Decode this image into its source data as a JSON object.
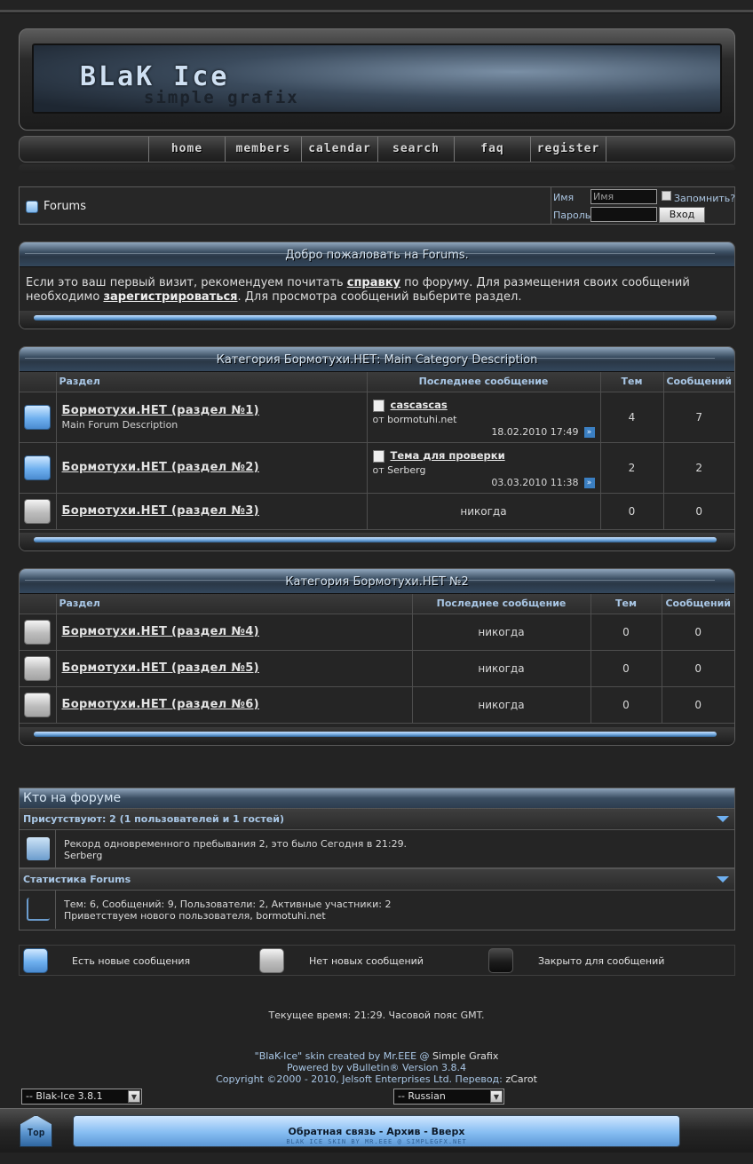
{
  "header": {
    "logo_line1": "BLaK Ice",
    "logo_line2": "simple grafix"
  },
  "nav": [
    "home",
    "members",
    "calendar",
    "search",
    "faq",
    "register"
  ],
  "breadcrumb": {
    "title": "Forums"
  },
  "login": {
    "user_label": "Имя",
    "user_value": "Имя",
    "remember_label": "Запомнить?",
    "pass_label": "Пароль",
    "submit": "Вход"
  },
  "welcome": {
    "title": "Добро пожаловать на Forums.",
    "text_a": "Если это ваш первый визит, рекомендуем почитать ",
    "link_help": "справку",
    "text_b": " по форуму. Для размещения своих сообщений необходимо ",
    "link_register": "зарегистрироваться",
    "text_c": ". Для просмотра сообщений выберите раздел."
  },
  "category1": {
    "title": "Категория Бормотухи.НЕТ: Main Category Description",
    "col_forum": "Раздел",
    "col_last": "Последнее сообщение",
    "col_threads": "Тем",
    "col_posts": "Сообщений",
    "rows": [
      {
        "name": "Бормотухи.НЕТ (раздел №1)",
        "desc": "Main Forum Description",
        "last_title": "cascascas",
        "last_by": "от",
        "last_user": "bormotuhi.net",
        "last_date": "18.02.2010 17:49",
        "threads": "4",
        "posts": "7"
      },
      {
        "name": "Бормотухи.НЕТ (раздел №2)",
        "desc": "",
        "last_title": "Тема для проверки",
        "last_by": "от",
        "last_user": "Serberg",
        "last_date": "03.03.2010 11:38",
        "threads": "2",
        "posts": "2"
      },
      {
        "name": "Бормотухи.НЕТ (раздел №3)",
        "desc": "",
        "last_never": "никогда",
        "threads": "0",
        "posts": "0"
      }
    ]
  },
  "category2": {
    "title": "Категория Бормотухи.НЕТ №2",
    "col_forum": "Раздел",
    "col_last": "Последнее сообщение",
    "col_threads": "Тем",
    "col_posts": "Сообщений",
    "rows": [
      {
        "name": "Бормотухи.НЕТ (раздел №4)",
        "last_never": "никогда",
        "threads": "0",
        "posts": "0"
      },
      {
        "name": "Бормотухи.НЕТ (раздел №5)",
        "last_never": "никогда",
        "threads": "0",
        "posts": "0"
      },
      {
        "name": "Бормотухи.НЕТ (раздел №6)",
        "last_never": "никогда",
        "threads": "0",
        "posts": "0"
      }
    ]
  },
  "whosonline": {
    "title": "Кто на форуме",
    "present_link": "Присутствуют",
    "present_text": ": 2 (1 пользователей и 1 гостей)",
    "record_text": "Рекорд одновременного пребывания 2, это было Сегодня в 21:29.",
    "record_user": "Serberg",
    "stats_title": "Статистика Forums",
    "stats_text": "Тем: 6, Сообщений: 9, Пользователи: 2, Активные участники: 2",
    "welcome_new": "Приветствуем нового пользователя, ",
    "new_user": "bormotuhi.net"
  },
  "legend": {
    "new": "Есть новые сообщения",
    "old": "Нет новых сообщений",
    "closed": "Закрыто для сообщений"
  },
  "footer": {
    "time": "Текущее время: 21:29. Часовой пояс GMT.",
    "credit1_a": "\"BlaK-Ice\" skin created by Mr.EEE @ ",
    "credit1_link": "Simple Grafix",
    "credit2": "Powered by vBulletin® Version 3.8.4",
    "credit3_a": "Copyright ©2000 - 2010, Jelsoft Enterprises Ltd. Перевод: ",
    "credit3_link": "zCarot",
    "style_select": "-- Blak-Ice 3.8.1",
    "lang_select": "-- Russian",
    "top_btn": "Top",
    "links": "Обратная связь - Архив - Вверх",
    "skin_note": "BLAK ICE SKIN BY MR.EEE @ SIMPLEGFX.NET"
  },
  "colors": {
    "accent": "#7db5ea",
    "background": "#232323",
    "heading": "#a9c7e6"
  }
}
